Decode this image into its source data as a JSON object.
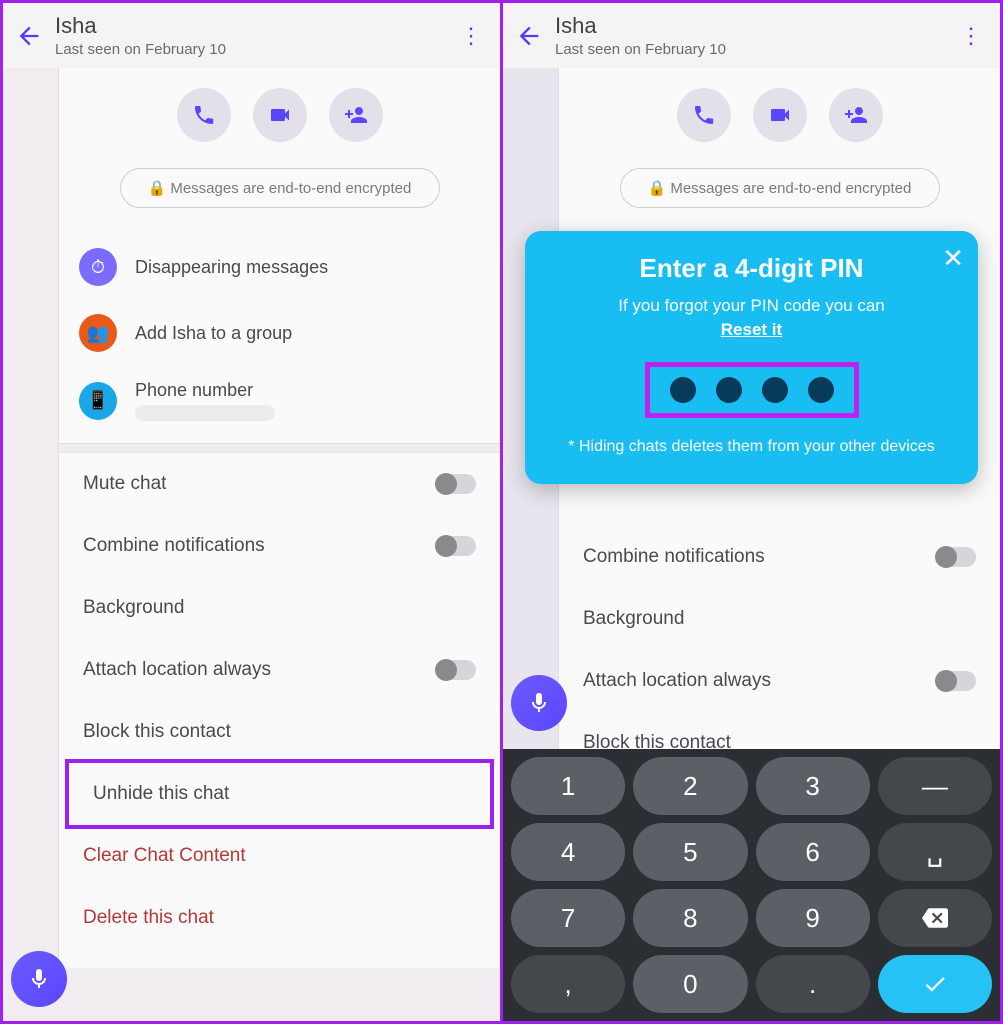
{
  "left": {
    "header": {
      "name": "Isha",
      "status": "Last seen on February 10"
    },
    "encryption": "Messages are end-to-end encrypted",
    "info_rows": {
      "disappearing": "Disappearing messages",
      "add_group": "Add Isha to a group",
      "phone": "Phone number"
    },
    "settings": {
      "mute": "Mute chat",
      "combine": "Combine notifications",
      "background": "Background",
      "location": "Attach location always",
      "block": "Block this contact",
      "unhide": "Unhide this chat",
      "clear": "Clear Chat Content",
      "delete": "Delete this chat"
    }
  },
  "right": {
    "header": {
      "name": "Isha",
      "status": "Last seen on February 10"
    },
    "encryption": "Messages are end-to-end encrypted",
    "modal": {
      "title": "Enter a 4-digit PIN",
      "subtitle": "If you forgot your PIN code you can",
      "reset": "Reset it",
      "footer": "* Hiding chats deletes them from your other devices"
    },
    "settings": {
      "combine": "Combine notifications",
      "background": "Background",
      "location": "Attach location always",
      "block": "Block this contact"
    },
    "keys": {
      "k1": "1",
      "k2": "2",
      "k3": "3",
      "k4": "4",
      "k5": "5",
      "k6": "6",
      "k7": "7",
      "k8": "8",
      "k9": "9",
      "k0": "0",
      "comma": ",",
      "dot": "."
    }
  }
}
